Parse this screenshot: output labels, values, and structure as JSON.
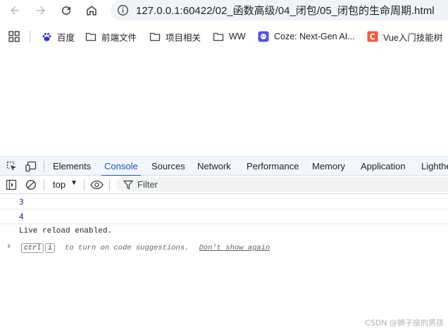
{
  "browser": {
    "url": "127.0.0.1:60422/02_函数高级/04_闭包/05_闭包的生命周期.html"
  },
  "bookmarks": [
    {
      "label": "百度",
      "icon": "baidu-paw-icon"
    },
    {
      "label": "前端文件",
      "icon": "folder-icon"
    },
    {
      "label": "项目相关",
      "icon": "folder-icon"
    },
    {
      "label": "WW",
      "icon": "folder-icon"
    },
    {
      "label": "Coze: Next-Gen AI...",
      "icon": "coze-icon"
    },
    {
      "label": "Vue入门技能树",
      "icon": "csdn-icon"
    }
  ],
  "devtools": {
    "tabs": [
      "Elements",
      "Console",
      "Sources",
      "Network",
      "Performance",
      "Memory",
      "Application",
      "Lighthe"
    ],
    "active_tab": "Console",
    "context": "top",
    "filter_placeholder": "Filter"
  },
  "console": {
    "logs": [
      "3",
      "4"
    ],
    "message": "Live reload enabled.",
    "hint": {
      "key1": "ctrl",
      "key2": "i",
      "text": "to turn on code suggestions.",
      "link": "Don't show again"
    }
  },
  "watermark": "CSDN @狮子座的男孩",
  "colors": {
    "accent": "#0b57d0",
    "log_number": "#1a1aa6",
    "devtools_tabbar": "#f3f6fc"
  }
}
